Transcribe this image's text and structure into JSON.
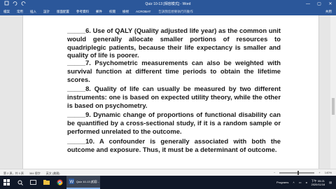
{
  "window": {
    "title": "Quiz 10-13 [相容模式] - Word",
    "controls": {
      "minimize": "—",
      "maximize": "▢",
      "close": "✕"
    }
  },
  "ribbon": {
    "tabs": [
      "檔案",
      "常用",
      "插入",
      "設計",
      "版面配置",
      "參考資料",
      "郵件",
      "校閱",
      "檢視",
      "ACROBAT"
    ],
    "tell_me": "告訴我您想要執行的動作",
    "share": "共用"
  },
  "document": {
    "paragraphs": [
      {
        "blank": "_____",
        "text": "6. Use of QALY (Quality adjusted life year) as the common unit would generally allocate smaller portions of resources to quadriplegic patients, because their life expectancy is smaller and quality of life is poorer."
      },
      {
        "blank": "_____",
        "text": "7. Psychometric measurements can also be weighted with survival function at different time periods to obtain the lifetime scores."
      },
      {
        "blank": "_____",
        "text": "8. Quality of life can usually be measured by two different instruments: one is based on expected utility theory, while the other is based on psychometry."
      },
      {
        "blank": "_____",
        "text": "9. Dynamic change of proportions of functional disability can be quantified by a cross-sectional study, if it is a random sample or performed unrelated to the outcome."
      },
      {
        "blank": "_____",
        "text": "10. A confounder is generally associated with both the outcome and exposure. Thus, it must be a determinant of outcome."
      }
    ]
  },
  "status": {
    "page": "第 2 頁，共 3 頁",
    "words": "384 個字",
    "language": "英文 (美國)",
    "zoom": "140%"
  },
  "taskbar": {
    "active_app": "Quiz 10-13 [相容...",
    "tray_label": "Programs",
    "time": "下午 05:21",
    "date": "2020/11/16"
  }
}
